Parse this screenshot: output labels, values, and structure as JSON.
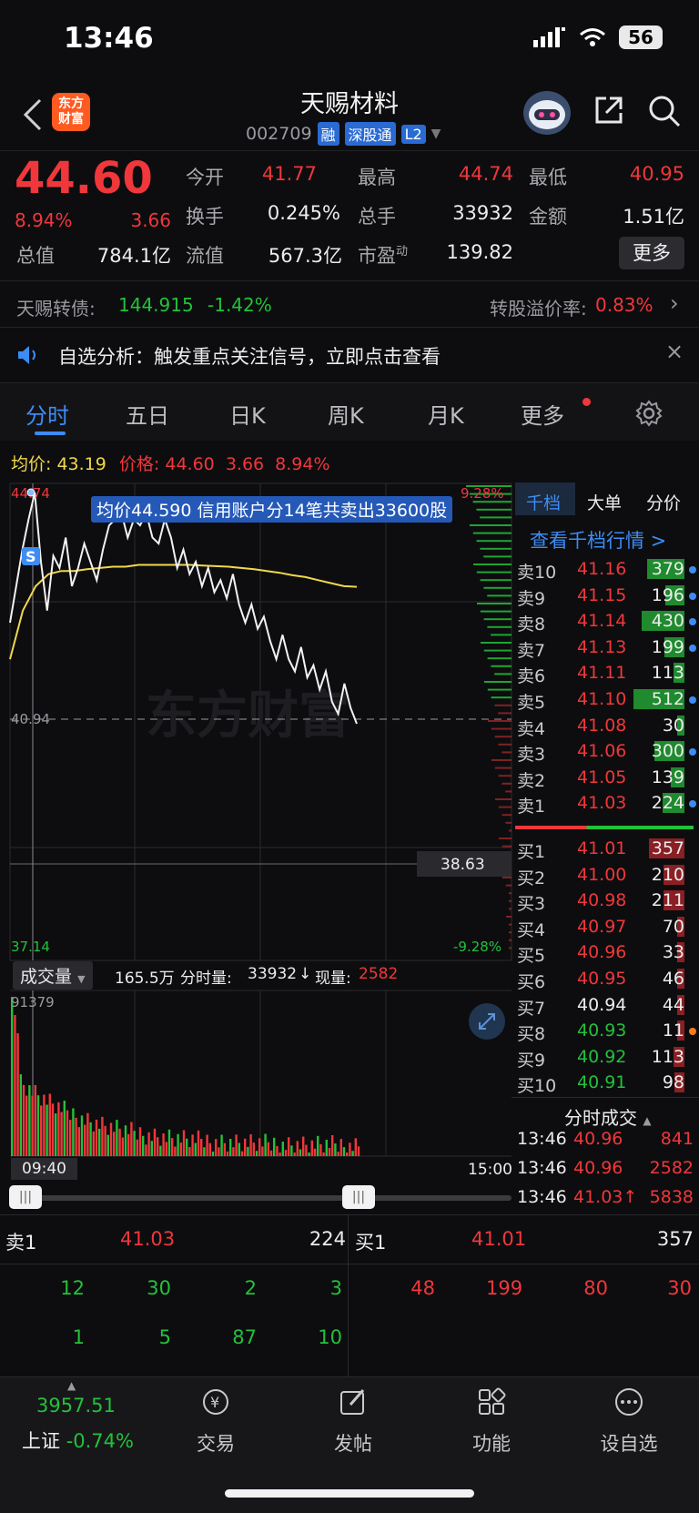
{
  "status_bar": {
    "time": "13:46",
    "battery": "56"
  },
  "header": {
    "app_logo": "东方\n财富",
    "stock_name": "天赐材料",
    "stock_code": "002709",
    "tags": [
      "融",
      "深股通",
      "L2"
    ]
  },
  "quote": {
    "price": "44.60",
    "change_pct": "8.94%",
    "change": "3.66",
    "fields": [
      {
        "label": "今开",
        "value": "41.77",
        "color": "red"
      },
      {
        "label": "最高",
        "value": "44.74",
        "color": "red"
      },
      {
        "label": "最低",
        "value": "40.95",
        "color": "red"
      },
      {
        "label": "换手",
        "value": "0.245%",
        "color": "white"
      },
      {
        "label": "总手",
        "value": "33932",
        "color": "white"
      },
      {
        "label": "金额",
        "value": "1.51亿",
        "color": "white"
      },
      {
        "label": "总值",
        "value": "784.1亿",
        "color": "white"
      },
      {
        "label": "流值",
        "value": "567.3亿",
        "color": "white"
      },
      {
        "label": "市盈",
        "sup": "动",
        "value": "139.82",
        "color": "white"
      }
    ],
    "more_label": "更多"
  },
  "bond": {
    "name": "天赐转债:",
    "price": "144.915",
    "change": "-1.42%",
    "premium_label": "转股溢价率:",
    "premium_value": "0.83%"
  },
  "notice": {
    "text": "自选分析：触发重点关注信号，立即点击查看"
  },
  "tabs": [
    "分时",
    "五日",
    "日K",
    "周K",
    "月K",
    "更多"
  ],
  "chart_info": {
    "avg_label": "均价:",
    "avg_value": "43.19",
    "price_label": "价格:",
    "price_value": "44.60",
    "change": "3.66",
    "pct": "8.94%"
  },
  "chart_data": {
    "type": "line",
    "y_top_label": "44.74",
    "y_bottom_label": "37.14",
    "pct_top": "9.28%",
    "pct_bottom": "-9.28%",
    "ylim": [
      37.14,
      44.74
    ],
    "current_line_label": "40.94",
    "crosshair_label": "38.63",
    "annotation": "均价44.590  信用账户分14笔共卖出33600股",
    "marker": "S",
    "watermark": "东方财富",
    "series": [
      {
        "values": [
          42.6,
          43.2,
          43.8,
          44.3,
          44.74,
          43.6,
          42.8,
          43.7,
          43.5,
          44.0,
          43.2,
          43.5,
          43.9,
          43.6,
          43.3,
          43.8,
          44.2,
          44.3,
          44.4,
          44.0,
          44.3,
          44.2,
          44.4,
          44.0,
          43.9,
          44.3,
          44.0,
          43.5,
          43.8,
          43.4,
          43.6,
          43.2,
          43.5,
          43.1,
          43.3,
          43.0,
          43.4,
          42.9,
          42.6,
          42.9,
          42.5,
          42.7,
          42.3,
          42.0,
          42.4,
          42.0,
          41.8,
          42.2,
          41.7,
          41.9,
          41.5,
          41.8,
          41.3,
          41.1,
          41.6,
          41.2,
          40.94
        ]
      },
      {
        "values": [
          42.0,
          42.8,
          43.2,
          43.4,
          43.45,
          43.45,
          43.48,
          43.5,
          43.52,
          43.52,
          43.55,
          43.55,
          43.55,
          43.55,
          43.55,
          43.54,
          43.53,
          43.52,
          43.5,
          43.48,
          43.45,
          43.42,
          43.38,
          43.35,
          43.3,
          43.25,
          43.2,
          43.19
        ]
      }
    ]
  },
  "volume": {
    "selector": "成交量",
    "total": "165.5万",
    "fenshi_label": "分时量:",
    "fenshi_value": "33932",
    "arrow": "↓",
    "now_label": "现量:",
    "now_value": "2582",
    "max_label": "91379",
    "start_time": "09:40",
    "end_time": "15:00"
  },
  "book": {
    "tabs": [
      "千档",
      "大单",
      "分价"
    ],
    "link": "查看千档行情 >",
    "asks": [
      {
        "label": "卖10",
        "price": "41.16",
        "vol": "379"
      },
      {
        "label": "卖9",
        "price": "41.15",
        "vol": "196"
      },
      {
        "label": "卖8",
        "price": "41.14",
        "vol": "430"
      },
      {
        "label": "卖7",
        "price": "41.13",
        "vol": "199"
      },
      {
        "label": "卖6",
        "price": "41.11",
        "vol": "113"
      },
      {
        "label": "卖5",
        "price": "41.10",
        "vol": "512"
      },
      {
        "label": "卖4",
        "price": "41.08",
        "vol": "30"
      },
      {
        "label": "卖3",
        "price": "41.06",
        "vol": "300"
      },
      {
        "label": "卖2",
        "price": "41.05",
        "vol": "139"
      },
      {
        "label": "卖1",
        "price": "41.03",
        "vol": "224"
      }
    ],
    "bids": [
      {
        "label": "买1",
        "price": "41.01",
        "vol": "357"
      },
      {
        "label": "买2",
        "price": "41.00",
        "vol": "210"
      },
      {
        "label": "买3",
        "price": "40.98",
        "vol": "211"
      },
      {
        "label": "买4",
        "price": "40.97",
        "vol": "70"
      },
      {
        "label": "买5",
        "price": "40.96",
        "vol": "33"
      },
      {
        "label": "买6",
        "price": "40.95",
        "vol": "46"
      },
      {
        "label": "买7",
        "price": "40.94",
        "vol": "44"
      },
      {
        "label": "买8",
        "price": "40.93",
        "vol": "11"
      },
      {
        "label": "买9",
        "price": "40.92",
        "vol": "113"
      },
      {
        "label": "买10",
        "price": "40.91",
        "vol": "98"
      }
    ],
    "trades_title": "分时成交",
    "trades": [
      {
        "time": "13:46",
        "price": "40.96",
        "vol": "841"
      },
      {
        "time": "13:46",
        "price": "40.96",
        "vol": "2582"
      },
      {
        "time": "13:46",
        "price": "41.03↑",
        "vol": "5838"
      }
    ]
  },
  "summary": {
    "sell_label": "卖1",
    "sell_price": "41.03",
    "sell_vol": "224",
    "buy_label": "买1",
    "buy_price": "41.01",
    "buy_vol": "357",
    "sell_queue_row1": [
      "12",
      "30",
      "2",
      "3"
    ],
    "sell_queue_row2": [
      "1",
      "5",
      "87",
      "10"
    ],
    "buy_queue_row1": [
      "48",
      "199",
      "80",
      "30"
    ]
  },
  "nav": {
    "index_value": "3957.51",
    "index_name": "上证",
    "index_change": "-0.74%",
    "items": [
      "交易",
      "发帖",
      "功能",
      "设自选"
    ]
  }
}
